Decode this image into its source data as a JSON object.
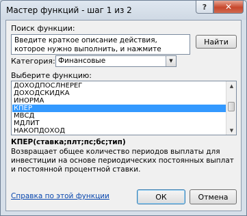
{
  "window": {
    "title": "Мастер функций - шаг 1 из 2",
    "help_label": "?",
    "close_label": "✕"
  },
  "search": {
    "label": "Поиск функции:",
    "value": "Введите краткое описание действия, которое нужно выполнить, и нажмите кнопку \"Найти\"",
    "button_label": "Найти"
  },
  "category": {
    "label": "Категория:",
    "value": "Финансовые",
    "arrow_icon": "chevron-down-icon"
  },
  "function_list": {
    "label": "Выберите функцию:",
    "items": [
      "ДОХОДПОСЛНЕРЕГ",
      "ДОХОДСКИДКА",
      "ИНОРМА",
      "КПЕР",
      "МВСД",
      "МДЛИТ",
      "НАКОПДОХОД"
    ],
    "selected_index": 3
  },
  "details": {
    "syntax": "КПЕР(ставка;плт;пс;бс;тип)",
    "description": "Возвращает общее количество периодов выплаты для инвестиции на основе периодических постоянных выплат и постоянной процентной ставки."
  },
  "footer": {
    "help_link": "Справка по этой функции",
    "ok_label": "ОК",
    "cancel_label": "Отмена"
  },
  "colors": {
    "selection": "#3399ff",
    "link": "#0645ad",
    "close_button": "#c7472c"
  }
}
